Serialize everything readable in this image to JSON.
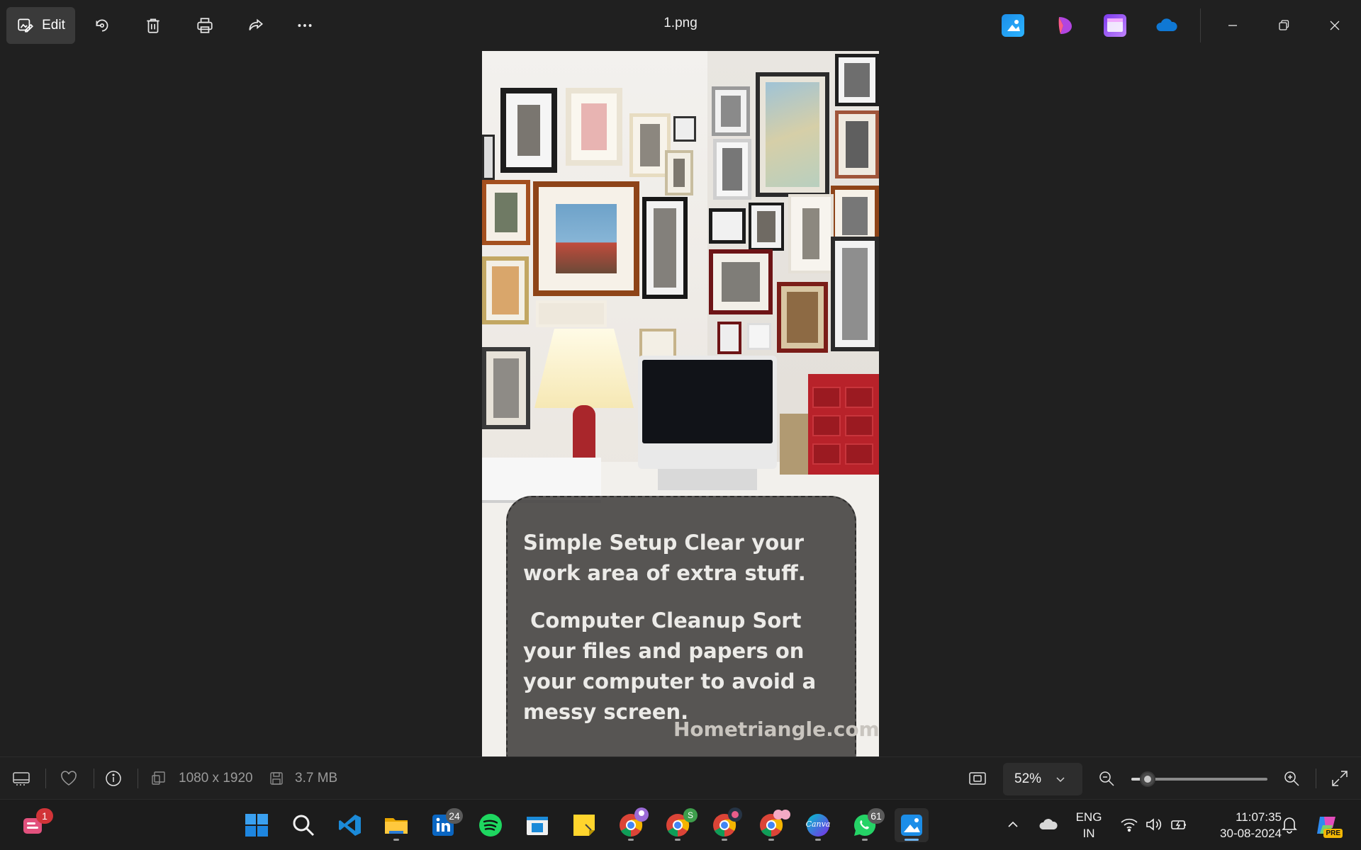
{
  "toolbar": {
    "edit_label": "Edit",
    "file_title": "1.png"
  },
  "image_text": {
    "paragraph_1": "Simple Setup Clear your work area of extra stuff.",
    "paragraph_2": " Computer Cleanup Sort your files and papers on your computer to avoid a messy screen.",
    "watermark": "Hometriangle.com"
  },
  "infobar": {
    "dimensions": "1080 x 1920",
    "file_size": "3.7 MB",
    "zoom": "52%",
    "zoom_fraction": 0.12
  },
  "taskbar": {
    "badges": {
      "notification_app": "1",
      "linkedin": "24",
      "chrome_profile_2": "S",
      "whatsapp": "61"
    },
    "canva_label": "Canva",
    "language_primary": "ENG",
    "language_region": "IN",
    "time": "11:07:35",
    "date": "30-08-2024",
    "copilot_badge": "PRE"
  },
  "colors": {
    "accent": "#60cdff",
    "background": "#202020",
    "taskbar": "#1c1c1c"
  }
}
